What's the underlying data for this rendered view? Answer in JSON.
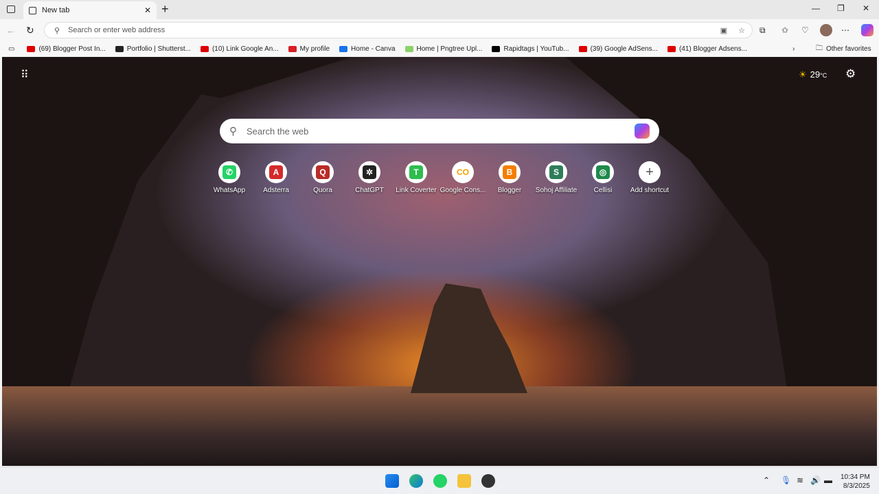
{
  "tab": {
    "title": "New tab"
  },
  "address": {
    "placeholder": "Search or enter web address"
  },
  "bookmarks": [
    {
      "label": "(69) Blogger Post In...",
      "color": "#e00000"
    },
    {
      "label": "Portfolio | Shutterst...",
      "color": "#222"
    },
    {
      "label": "(10) Link Google An...",
      "color": "#e00000"
    },
    {
      "label": "My profile",
      "color": "#d81f26"
    },
    {
      "label": "Home - Canva",
      "color": "#1a73e8"
    },
    {
      "label": "Home | Pngtree Upl...",
      "color": "#8bd16a"
    },
    {
      "label": "Rapidtags | YouTub...",
      "color": "#000"
    },
    {
      "label": "(39) Google AdSens...",
      "color": "#e00000"
    },
    {
      "label": "(41) Blogger Adsens...",
      "color": "#e00000"
    }
  ],
  "other_favorites": "Other favorites",
  "weather": {
    "temp": "29",
    "unit": "°C"
  },
  "search": {
    "placeholder": "Search the web"
  },
  "shortcuts": [
    {
      "label": "WhatsApp",
      "glyph": "✆",
      "color": "#25d366"
    },
    {
      "label": "Adsterra",
      "glyph": "A",
      "color": "#d42a2a"
    },
    {
      "label": "Quora",
      "glyph": "Q",
      "color": "#b92b27"
    },
    {
      "label": "ChatGPT",
      "glyph": "✲",
      "color": "#222"
    },
    {
      "label": "Link Coverter",
      "glyph": "T",
      "color": "#2ebd4e"
    },
    {
      "label": "Google Cons...",
      "glyph": "CO",
      "color": "#f0a500"
    },
    {
      "label": "Blogger",
      "glyph": "B",
      "color": "#f57d00"
    },
    {
      "label": "Sohoj Affiliate",
      "glyph": "S",
      "color": "#2e7d5b"
    },
    {
      "label": "Cellisi",
      "glyph": "◎",
      "color": "#1e8a4a"
    },
    {
      "label": "Add shortcut",
      "glyph": "+",
      "color": "#555"
    }
  ],
  "clock": {
    "time": "10:34 PM",
    "date": "8/3/2025"
  }
}
